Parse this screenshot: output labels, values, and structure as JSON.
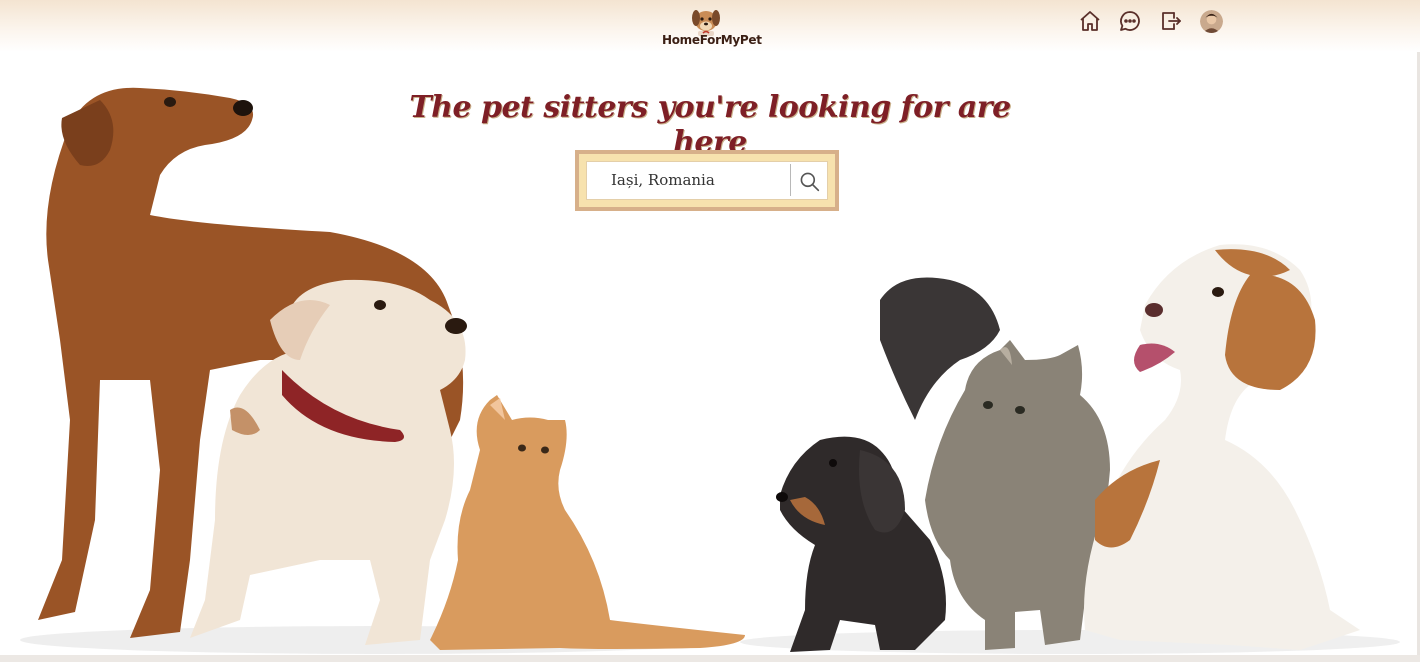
{
  "app": {
    "logo_text": "HomeForMyPet"
  },
  "nav": {
    "items": [
      {
        "name": "home",
        "icon": "home-icon"
      },
      {
        "name": "messages",
        "icon": "chat-bubble-icon"
      },
      {
        "name": "logout",
        "icon": "logout-icon"
      },
      {
        "name": "profile",
        "icon": "avatar"
      }
    ]
  },
  "hero": {
    "title": "The pet sitters you're looking for are here"
  },
  "search": {
    "value": "Iași, Romania",
    "icon": "search-icon"
  },
  "colors": {
    "title": "#7e1f26",
    "frame_border": "#d7b08a",
    "frame_fill": "#f7e2ae",
    "header_top": "#f4e4d1",
    "dog_brown": "#9a5426",
    "beagle_tan": "#b8743c"
  }
}
